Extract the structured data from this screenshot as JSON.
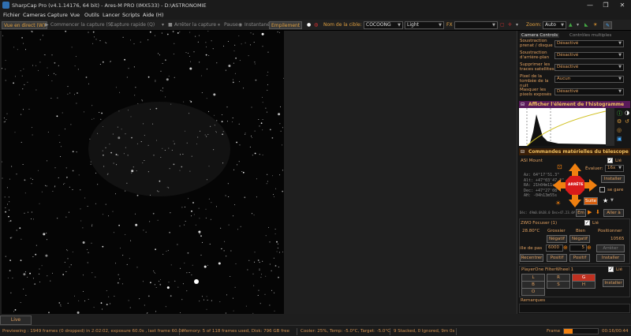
{
  "window": {
    "title": "SharpCap Pro (v4.1.14176, 64 bit) - Ares-M PRO (IMX533) - D:\\ASTRONOMIE",
    "minimize": "—",
    "maximize": "❐",
    "close": "✕"
  },
  "menu": [
    "Fichier",
    "Cameras",
    "Capture",
    "Vue",
    "Outils",
    "Lancer",
    "Scripts",
    "Aide (H)"
  ],
  "toolbar": {
    "live_view": "Vue en direct (W)",
    "start_capture": "Commencer la capture (S)",
    "quick_capture": "Capture rapide (Q)",
    "stop_capture": "Arrêter la capture",
    "pause": "Pause",
    "snapshot": "Instantané",
    "stacking": "Empilement",
    "target_label": "Nom de la cible:",
    "target_value": "COCOONG",
    "light_value": "Light",
    "fx_label": "FX",
    "zoom_label": "Zoom:",
    "zoom_value": "Auto"
  },
  "camera_controls": {
    "tab_active": "Camera Controls",
    "tab_inactive": "Contrôles multiples",
    "rows": [
      {
        "label": "Soustraction prenat / disque",
        "value": "Désactivé"
      },
      {
        "label": "Soustraction d'arrière-plan",
        "value": "Désactivé"
      },
      {
        "label": "Supprimer les traces satellites",
        "value": "Désactivé"
      },
      {
        "label": "Pixel de la tombée de la nuit",
        "value": "Aucun"
      },
      {
        "label": "Masquer les pixels exposés",
        "value": "Désactivé"
      }
    ]
  },
  "histogram": {
    "header": "Afficher l'élément de l'histogramme"
  },
  "telescope": {
    "header": "Commandes matérielles du télescope",
    "mount_label": "ASI Mount",
    "connected": "Lié",
    "evaluate_label": "Évaluer:",
    "rate_value": "16x",
    "install_button": "Installer",
    "stop_button": "ARRÊTE",
    "follow_button": "Suite",
    "reverse_label": "se gare",
    "coords": [
      "Az:  64°17'51.3\"",
      "Alt: +47°03'47.2\"",
      "RA:  21h04m11s",
      "Dec: +47°27'08\"",
      "AH:  -04h13m55s"
    ],
    "coords_summary": "Déc: 49m0.0h38.0  Dec+47.23.4#",
    "em_button": "Em",
    "go_button": "Aller à"
  },
  "focuser": {
    "title": "ZWO Focuser (1)",
    "connected": "Lié",
    "temperature": "28.80°C",
    "coarse_label": "Grossier",
    "fine_label": "Bien",
    "position_label": "Positionner",
    "neg_coarse": "Négatif",
    "neg_fine": "Négatif",
    "position_value": "10565",
    "step_label": "ille de pas",
    "step_coarse": "6000",
    "step_fine": "5",
    "stop_button": "Arrêter",
    "retract_button": "Recentrer",
    "pos_coarse": "Positif",
    "pos_fine": "Positif",
    "install_button": "Installer"
  },
  "filterwheel": {
    "title": "PlayerOne FilterWheel 1",
    "connected": "Lié",
    "filters": [
      "L",
      "R",
      "G",
      "B",
      "S",
      "H",
      "O"
    ],
    "active_filter": "G",
    "install_button": "Installer"
  },
  "remarks": {
    "label": "Remarques"
  },
  "live_stacking": "Live Stacking",
  "status": {
    "previewing": "Previewing : 1949 frames (0 dropped) in 2:02:02, exposure 60.0s , last frame 60.0s",
    "memory": "Memory: 5 of 118 frames used, Disk: 796 GB free",
    "cooler": "Cooler: 25%, Temp: -5.0°C, Target: -5.0°C",
    "stacked": "9 Stacked, 0 Ignored, 9m 0s",
    "frame_label": "Frame",
    "frame_progress": 0.25,
    "time": "00:16/00:44"
  },
  "colors": {
    "accent": "#e0a060",
    "stop_red": "#d81b1b",
    "arrow_orange": "#f08010",
    "histogram_header": "#5a1a5a",
    "telescope_header": "#3a1f08"
  }
}
